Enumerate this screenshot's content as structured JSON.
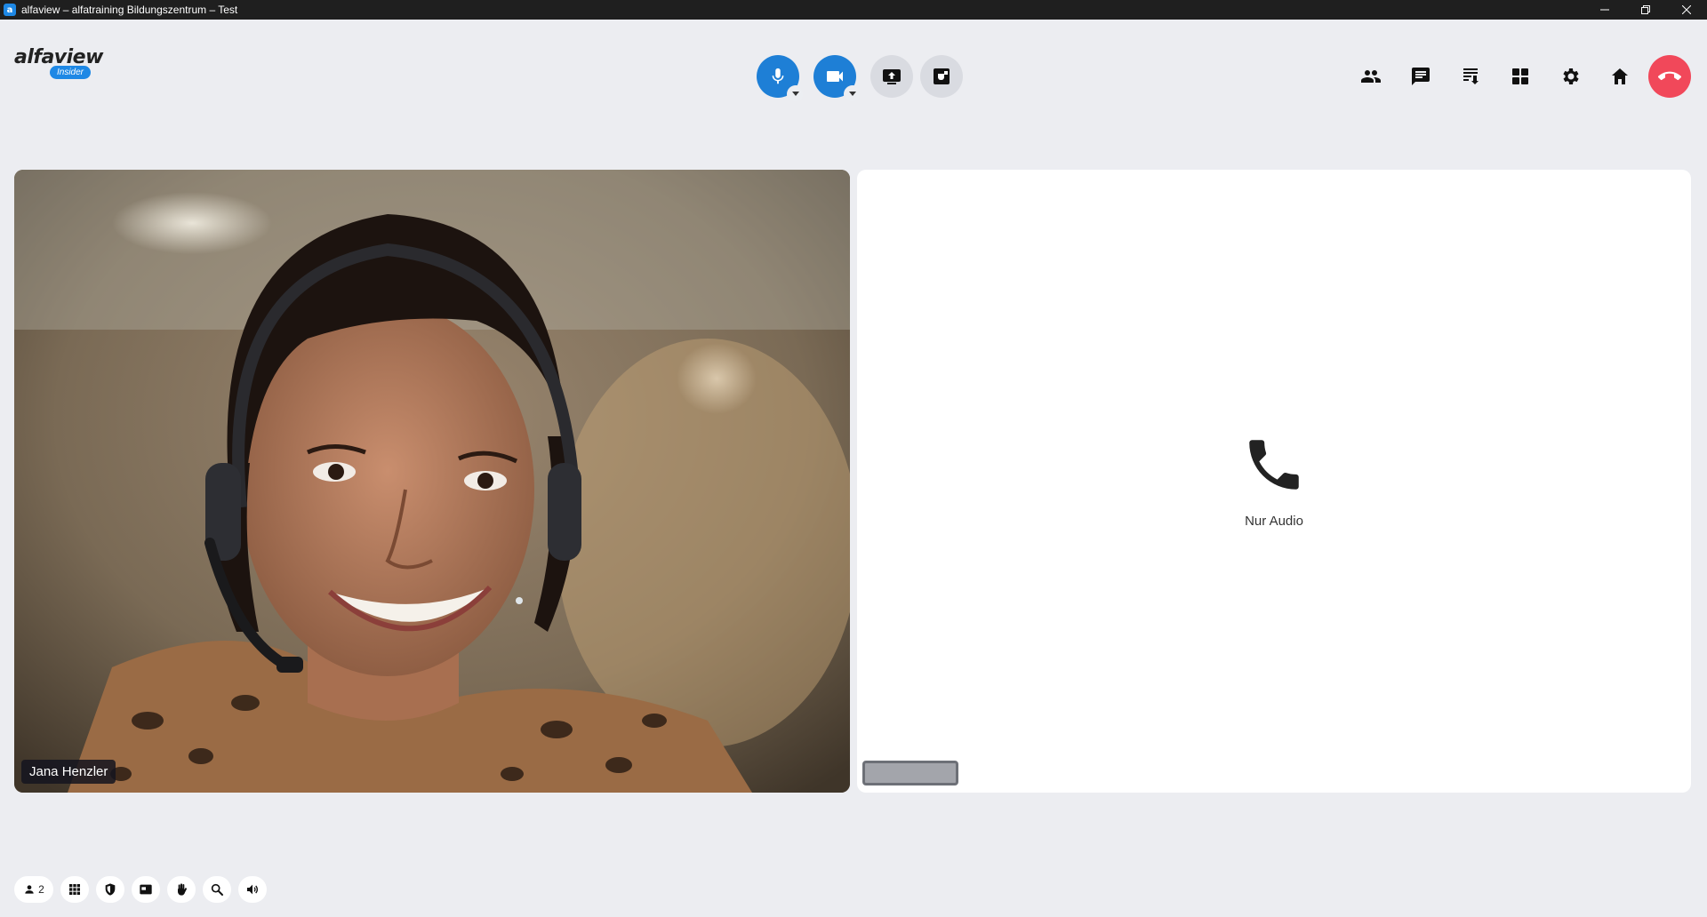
{
  "window": {
    "title": "alfaview – alfatraining Bildungszentrum – Test",
    "app_icon_letter": "a",
    "controls": [
      "minimize",
      "restore",
      "close"
    ]
  },
  "header": {
    "logo_text": "alfaview",
    "logo_badge": "Insider",
    "center_buttons": [
      {
        "name": "microphone",
        "icon": "mic-icon",
        "state": "on",
        "color": "#1e7fd6",
        "has_dropdown": true
      },
      {
        "name": "camera",
        "icon": "videocam-icon",
        "state": "on",
        "color": "#1e7fd6",
        "has_dropdown": true
      },
      {
        "name": "screen-share",
        "icon": "screen-share-icon",
        "state": "off",
        "color": "#d9dbe1"
      },
      {
        "name": "break",
        "icon": "coffee-icon",
        "state": "off",
        "color": "#d9dbe1"
      }
    ],
    "right_buttons": [
      {
        "name": "participants",
        "icon": "people-icon"
      },
      {
        "name": "chat",
        "icon": "chat-icon"
      },
      {
        "name": "notes",
        "icon": "notes-icon"
      },
      {
        "name": "rooms",
        "icon": "grid-icon"
      },
      {
        "name": "settings",
        "icon": "gear-icon"
      },
      {
        "name": "home",
        "icon": "home-icon"
      },
      {
        "name": "leave",
        "icon": "hangup-icon",
        "color": "#f1485a"
      }
    ]
  },
  "tiles": [
    {
      "type": "video",
      "participant_name": "Jana Henzler"
    },
    {
      "type": "audio",
      "label": "Nur Audio",
      "participant_name": ""
    }
  ],
  "bottom_bar": {
    "participants_count": "2",
    "buttons": [
      "participants-icon",
      "keypad-icon",
      "shield-icon",
      "picture-in-picture-icon",
      "hand-icon",
      "search-icon",
      "speaker-icon"
    ]
  },
  "colors": {
    "accent": "#1e7fd6",
    "danger": "#f1485a",
    "background": "#ecedf1"
  }
}
